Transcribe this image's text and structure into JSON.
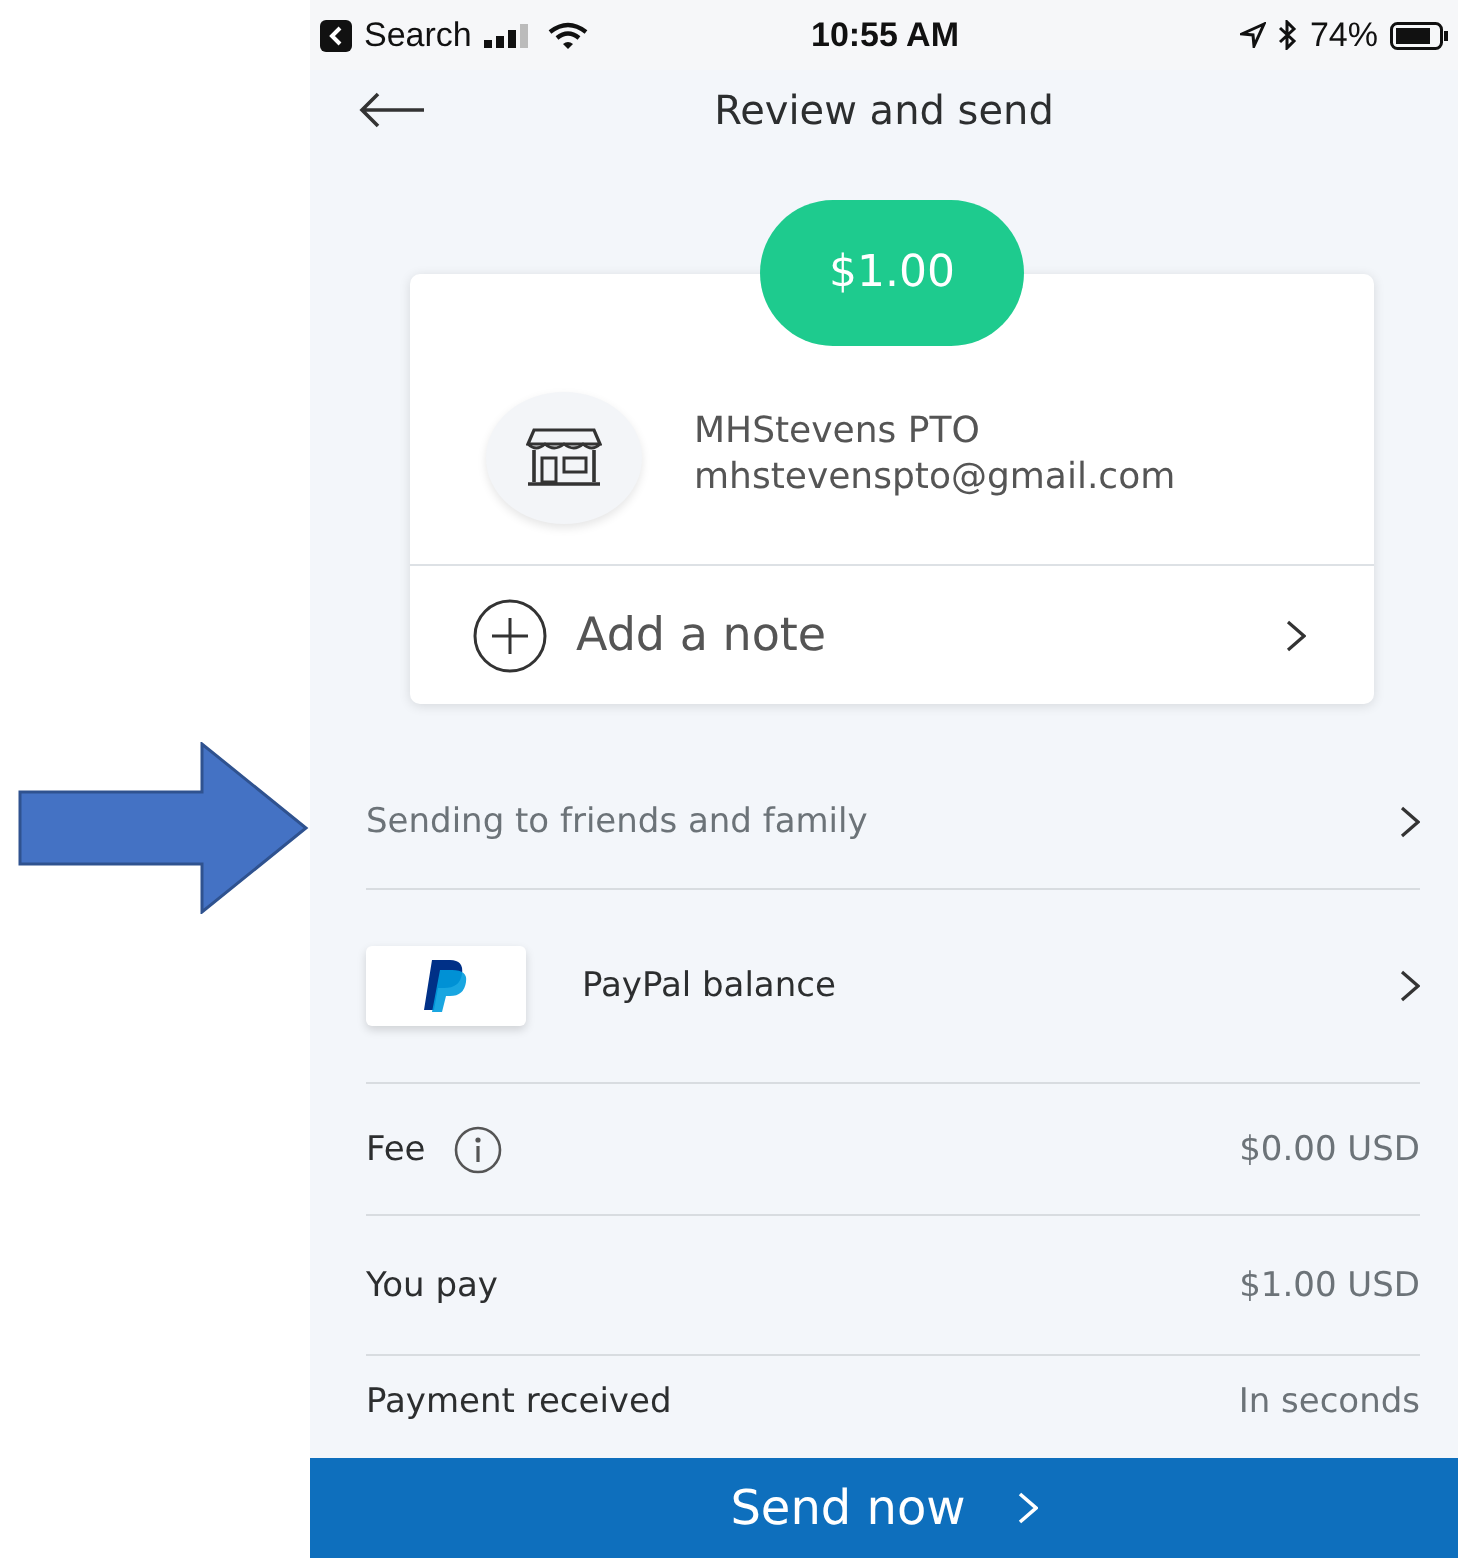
{
  "status_bar": {
    "back_label": "Search",
    "time": "10:55 AM",
    "battery": "74%"
  },
  "header": {
    "title": "Review and send"
  },
  "amount": "$1.00",
  "recipient": {
    "name": "MHStevens PTO",
    "email": "mhstevenspto@gmail.com"
  },
  "note_row": {
    "label": "Add a note"
  },
  "rows": [
    {
      "kind": "link",
      "label": "Sending to friends and family"
    },
    {
      "kind": "funding",
      "label": "PayPal balance"
    },
    {
      "kind": "info",
      "label": "Fee",
      "value": "$0.00 USD"
    },
    {
      "kind": "value",
      "label": "You pay",
      "value": "$1.00 USD"
    },
    {
      "kind": "value",
      "label": "Payment received",
      "value": "In seconds"
    }
  ],
  "primary_button": {
    "label": "Send now"
  }
}
